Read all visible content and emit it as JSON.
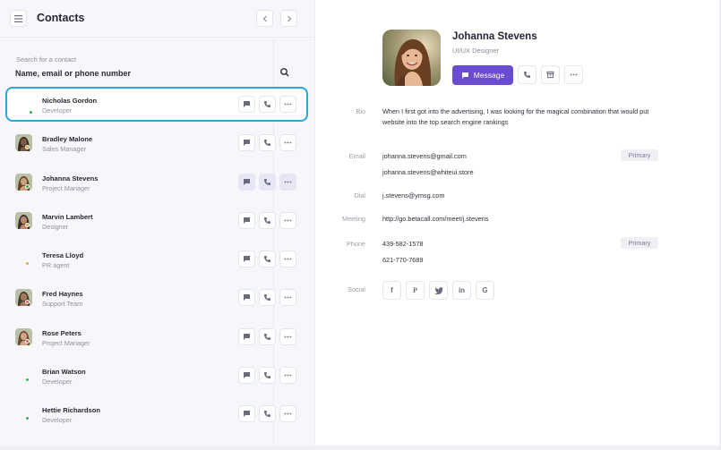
{
  "header": {
    "title": "Contacts"
  },
  "search": {
    "label": "Search for a contact",
    "placeholder": "Name, email or phone number"
  },
  "contacts": [
    {
      "name": "Nicholas Gordon",
      "role": "Developer",
      "status": "#2fb34d",
      "avatar": "none"
    },
    {
      "name": "Bradley Malone",
      "role": "Sales Manager",
      "status": "#f0a53a",
      "avatar": "photo"
    },
    {
      "name": "Johanna Stevens",
      "role": "Project Manager",
      "status": "#2fb34d",
      "avatar": "photo"
    },
    {
      "name": "Marvin Lambert",
      "role": "Designer",
      "status": "#f0a53a",
      "avatar": "photo"
    },
    {
      "name": "Teresa Lloyd",
      "role": "PR agent",
      "status": "#f0a53a",
      "avatar": "none"
    },
    {
      "name": "Fred Haynes",
      "role": "Support Team",
      "status": "#e0596b",
      "avatar": "photo"
    },
    {
      "name": "Rose Peters",
      "role": "Project Manager",
      "status": "#e0596b",
      "avatar": "photo"
    },
    {
      "name": "Brian Watson",
      "role": "Developer",
      "status": "#2fb34d",
      "avatar": "none"
    },
    {
      "name": "Hettie Richardson",
      "role": "Developer",
      "status": "#2fb34d",
      "avatar": "none"
    }
  ],
  "profile": {
    "name": "Johanna Stevens",
    "title": "UI/UX Designer",
    "message_label": "Message",
    "bio_label": "Bio",
    "bio": "When I first got into the advertising, I was looking for the magical combination that would put website into the top search engine rankings",
    "email_label": "Email",
    "emails": [
      "johanna.stevens@gmail.com",
      "johanna.stevens@whiteui.store"
    ],
    "primary_badge": "Primary",
    "dial_label": "Dial",
    "dial": "j.stevens@ymsg.com",
    "meeting_label": "Meeting",
    "meeting": "http://go.betacall.com/meet/j.stevens",
    "phone_label": "Phone",
    "phones": [
      "439-582-1578",
      "621-770-7689"
    ],
    "social_label": "Social",
    "social": [
      "f",
      "P",
      "twitter",
      "in",
      "G"
    ]
  },
  "colors": {
    "accent": "#6b4bd0",
    "selection": "#2aa6e2"
  }
}
